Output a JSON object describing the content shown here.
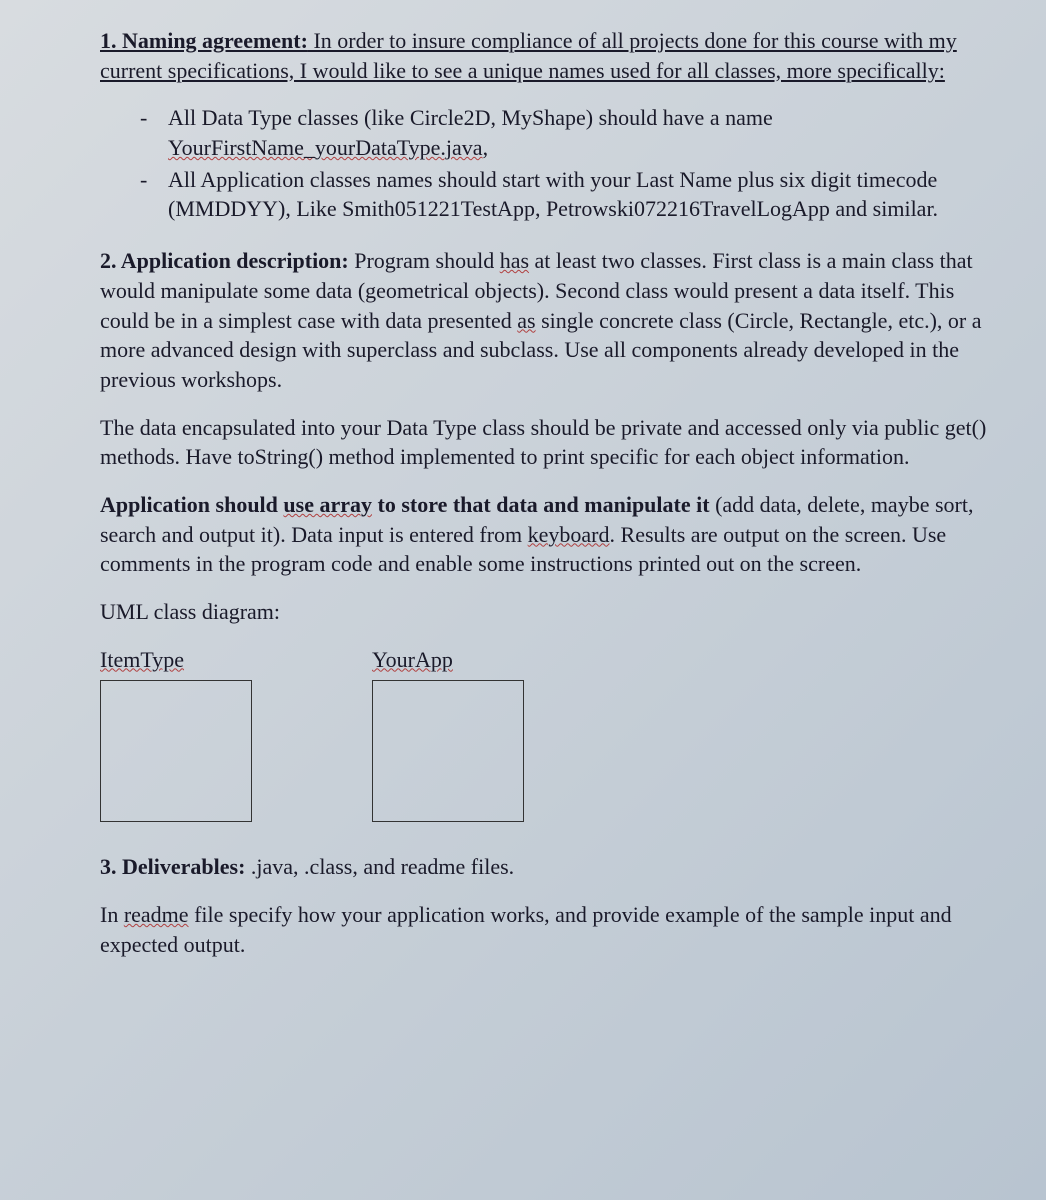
{
  "s1": {
    "heading": "1. Naming agreement:",
    "intro": " In order to insure compliance of all projects done for this course with my current specifications, I would like to see a unique names used for all classes, more specifically:",
    "bullet1a": "All Data Type classes (like Circle2D, MyShape) should have a name ",
    "bullet1b": "YourFirstName_yourDataType.java",
    "bullet1c": ",",
    "bullet2": "All Application classes names should start with your Last Name plus six digit timecode (MMDDYY),  Like Smith051221TestApp, Petrowski072216TravelLogApp and similar."
  },
  "s2": {
    "heading": "2. Application description:",
    "p1a": " Program should ",
    "p1_has": "has",
    "p1b": " at least two classes. First class is a main class that would manipulate some data (geometrical objects). Second class would present a data itself. This could be in a simplest case with data presented ",
    "p1_as": "as",
    "p1c": " single concrete class (Circle, Rectangle, etc.), or a more advanced design with superclass and subclass. Use all components already developed in the previous workshops.",
    "p2": "The data encapsulated into your Data Type class should be private and accessed only via public get() methods. Have toString() method implemented to print specific for each object information.",
    "p3_bold_a": "Application should ",
    "p3_bold_use": "use array",
    "p3_bold_b": " to store that data and manipulate it",
    "p3_rest_a": " (add data, delete, maybe sort, search and output it).  Data input is entered from ",
    "p3_keyboard": "keyboard",
    "p3_rest_b": ". Results are output on the screen. Use comments in the program code and enable some instructions printed out on the screen.",
    "uml_heading": "UML class diagram:",
    "uml_left": "ItemType",
    "uml_right": "YourApp"
  },
  "s3": {
    "heading": "3. Deliverables:",
    "text": "  .java, .class, and readme files.",
    "p1a": "In ",
    "p1_readme": "readme",
    "p1b": " file specify how your application works, and provide example of the sample input and expected output."
  }
}
